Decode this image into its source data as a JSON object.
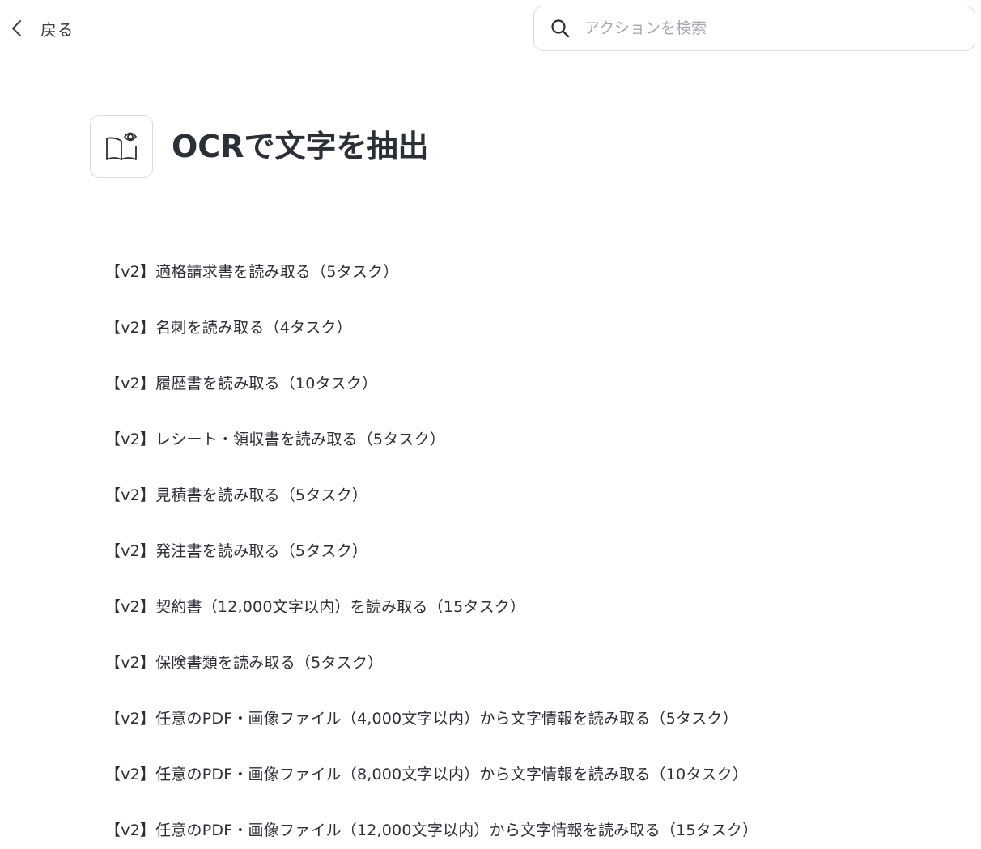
{
  "topbar": {
    "back_label": "戻る",
    "back_icon": "chevron-left-icon",
    "search": {
      "icon": "search-icon",
      "placeholder": "アクションを検索",
      "value": ""
    }
  },
  "header": {
    "icon": "book-eye-icon",
    "title": "OCRで文字を抽出"
  },
  "actions": [
    "【v2】適格請求書を読み取る（5タスク）",
    "【v2】名刺を読み取る（4タスク）",
    "【v2】履歴書を読み取る（10タスク）",
    "【v2】レシート・領収書を読み取る（5タスク）",
    "【v2】見積書を読み取る（5タスク）",
    "【v2】発注書を読み取る（5タスク）",
    "【v2】契約書（12,000文字以内）を読み取る（15タスク）",
    "【v2】保険書類を読み取る（5タスク）",
    "【v2】任意のPDF・画像ファイル（4,000文字以内）から文字情報を読み取る（5タスク）",
    "【v2】任意のPDF・画像ファイル（8,000文字以内）から文字情報を読み取る（10タスク）",
    "【v2】任意のPDF・画像ファイル（12,000文字以内）から文字情報を読み取る（15タスク）"
  ]
}
